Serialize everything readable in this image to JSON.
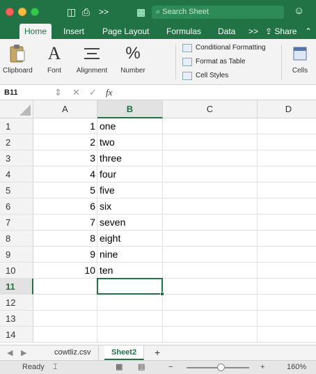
{
  "titlebar": {
    "search_placeholder": "Search Sheet",
    "overflow_label": ">>"
  },
  "tabs": [
    {
      "label": "Home",
      "active": true
    },
    {
      "label": "Insert"
    },
    {
      "label": "Page Layout"
    },
    {
      "label": "Formulas"
    },
    {
      "label": "Data"
    },
    {
      "label": ">>"
    },
    {
      "label": "Share"
    }
  ],
  "ribbon": {
    "clipboard": "Clipboard",
    "font": "Font",
    "alignment": "Alignment",
    "number": "Number",
    "conditional_formatting": "Conditional Formatting",
    "format_as_table": "Format as Table",
    "cell_styles": "Cell Styles",
    "cells": "Cells",
    "number_symbol": "%"
  },
  "formula_bar": {
    "name_box": "B11",
    "fx": "fx",
    "value": ""
  },
  "grid": {
    "columns": [
      "A",
      "B",
      "C",
      "D"
    ],
    "rows": [
      "1",
      "2",
      "3",
      "4",
      "5",
      "6",
      "7",
      "8",
      "9",
      "10",
      "11",
      "12",
      "13",
      "14"
    ],
    "data": [
      [
        "1",
        "one"
      ],
      [
        "2",
        "two"
      ],
      [
        "3",
        "three"
      ],
      [
        "4",
        "four"
      ],
      [
        "5",
        "five"
      ],
      [
        "6",
        "six"
      ],
      [
        "7",
        "seven"
      ],
      [
        "8",
        "eight"
      ],
      [
        "9",
        "nine"
      ],
      [
        "10",
        "ten"
      ]
    ],
    "selected_cell": "B11",
    "accent": "#217346"
  },
  "sheets": [
    {
      "label": "cowtliz.csv"
    },
    {
      "label": "Sheet2",
      "active": true
    }
  ],
  "sheet_add": "+",
  "status": {
    "ready": "Ready",
    "zoom_minus": "−",
    "zoom_plus": "+",
    "zoom": "160%"
  },
  "colors": {
    "brand": "#217346",
    "ribbon": "#f3f3f3"
  }
}
